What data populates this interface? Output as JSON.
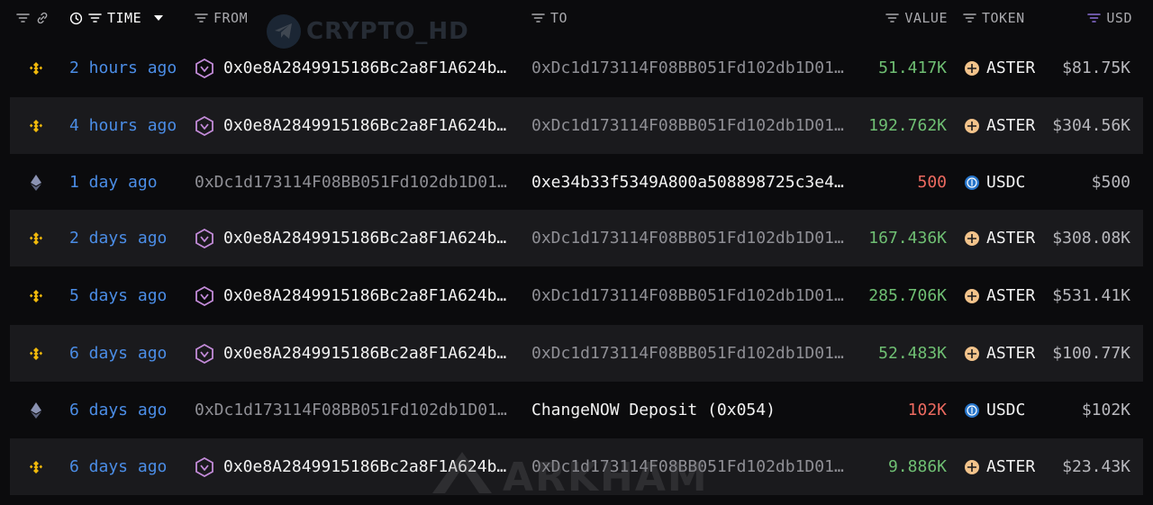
{
  "header": {
    "time": "TIME",
    "from": "FROM",
    "to": "TO",
    "value": "VALUE",
    "token": "TOKEN",
    "usd": "USD"
  },
  "watermarks": {
    "top": "CRYPTO_HD",
    "bottom": "ARKHAM"
  },
  "colors": {
    "time_link": "#4b8de6",
    "value_positive": "#6fbf73",
    "value_negative": "#ec6a60",
    "usd_header_filter": "#8b6fd6",
    "bnb_chain": "#f0b90b",
    "eth_chain": "#8a92b2",
    "aster_token": "#f2c38b",
    "usdc_token": "#2775ca"
  },
  "rows": [
    {
      "chain": "bnb-chain",
      "time": "2 hours ago",
      "from": "0x0e8A2849915186Bc2a8F1A624b…",
      "from_entity_icon": true,
      "to": "0xDc1d173114F08BB051Fd102db1D01…",
      "to_highlight": false,
      "value": "51.417K",
      "value_sign": "positive",
      "token": "ASTER",
      "usd": "$81.75K"
    },
    {
      "chain": "bnb-chain",
      "time": "4 hours ago",
      "from": "0x0e8A2849915186Bc2a8F1A624b…",
      "from_entity_icon": true,
      "to": "0xDc1d173114F08BB051Fd102db1D01…",
      "to_highlight": false,
      "value": "192.762K",
      "value_sign": "positive",
      "token": "ASTER",
      "usd": "$304.56K"
    },
    {
      "chain": "eth-chain",
      "time": "1 day ago",
      "from": "0xDc1d173114F08BB051Fd102db1D01…",
      "from_entity_icon": false,
      "to": "0xe34b33f5349A800a508898725c3e4…",
      "to_highlight": true,
      "value": "500",
      "value_sign": "negative",
      "token": "USDC",
      "usd": "$500"
    },
    {
      "chain": "bnb-chain",
      "time": "2 days ago",
      "from": "0x0e8A2849915186Bc2a8F1A624b…",
      "from_entity_icon": true,
      "to": "0xDc1d173114F08BB051Fd102db1D01…",
      "to_highlight": false,
      "value": "167.436K",
      "value_sign": "positive",
      "token": "ASTER",
      "usd": "$308.08K"
    },
    {
      "chain": "bnb-chain",
      "time": "5 days ago",
      "from": "0x0e8A2849915186Bc2a8F1A624b…",
      "from_entity_icon": true,
      "to": "0xDc1d173114F08BB051Fd102db1D01…",
      "to_highlight": false,
      "value": "285.706K",
      "value_sign": "positive",
      "token": "ASTER",
      "usd": "$531.41K"
    },
    {
      "chain": "bnb-chain",
      "time": "6 days ago",
      "from": "0x0e8A2849915186Bc2a8F1A624b…",
      "from_entity_icon": true,
      "to": "0xDc1d173114F08BB051Fd102db1D01…",
      "to_highlight": false,
      "value": "52.483K",
      "value_sign": "positive",
      "token": "ASTER",
      "usd": "$100.77K"
    },
    {
      "chain": "eth-chain",
      "time": "6 days ago",
      "from": "0xDc1d173114F08BB051Fd102db1D01…",
      "from_entity_icon": false,
      "to": "ChangeNOW Deposit (0x054)",
      "to_highlight": true,
      "value": "102K",
      "value_sign": "negative",
      "token": "USDC",
      "usd": "$102K"
    },
    {
      "chain": "bnb-chain",
      "time": "6 days ago",
      "from": "0x0e8A2849915186Bc2a8F1A624b…",
      "from_entity_icon": true,
      "to": "0xDc1d173114F08BB051Fd102db1D01…",
      "to_highlight": false,
      "value": "9.886K",
      "value_sign": "positive",
      "token": "ASTER",
      "usd": "$23.43K"
    }
  ]
}
